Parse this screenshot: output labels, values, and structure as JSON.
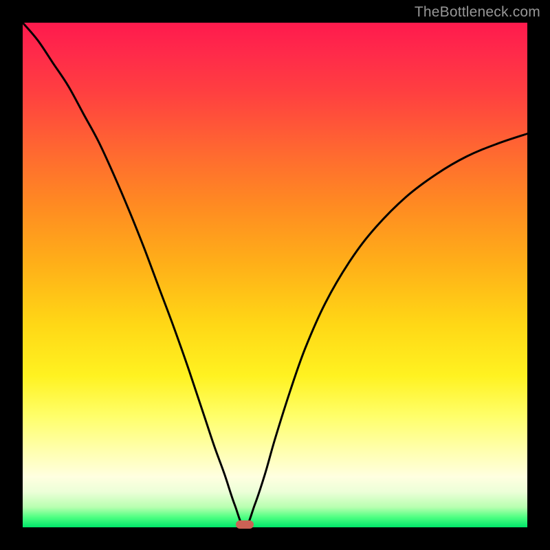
{
  "watermark": "TheBottleneck.com",
  "colors": {
    "curve_stroke": "#000000",
    "marker_fill": "#cc6155"
  },
  "chart_data": {
    "type": "line",
    "title": "",
    "xlabel": "",
    "ylabel": "",
    "xlim": [
      0,
      1
    ],
    "ylim": [
      0,
      1
    ],
    "notes": "V-shaped bottleneck curve over a rainbow gradient background. Axes have no visible tick labels. Values are estimated fractions of the plot area (x=0 left, y=0 bottom).",
    "minimum_x": 0.44,
    "marker": {
      "x": 0.44,
      "y": 0.005,
      "shape": "rounded-rect"
    },
    "series": [
      {
        "name": "bottleneck-curve",
        "x": [
          0.0,
          0.03,
          0.06,
          0.09,
          0.12,
          0.15,
          0.18,
          0.21,
          0.24,
          0.27,
          0.3,
          0.33,
          0.36,
          0.38,
          0.4,
          0.42,
          0.44,
          0.46,
          0.48,
          0.5,
          0.53,
          0.56,
          0.6,
          0.65,
          0.7,
          0.76,
          0.82,
          0.88,
          0.94,
          1.0
        ],
        "y": [
          1.0,
          0.965,
          0.92,
          0.875,
          0.82,
          0.765,
          0.7,
          0.63,
          0.555,
          0.475,
          0.395,
          0.31,
          0.22,
          0.16,
          0.105,
          0.045,
          0.0,
          0.045,
          0.105,
          0.175,
          0.27,
          0.355,
          0.445,
          0.53,
          0.595,
          0.655,
          0.7,
          0.735,
          0.76,
          0.78
        ]
      }
    ]
  }
}
